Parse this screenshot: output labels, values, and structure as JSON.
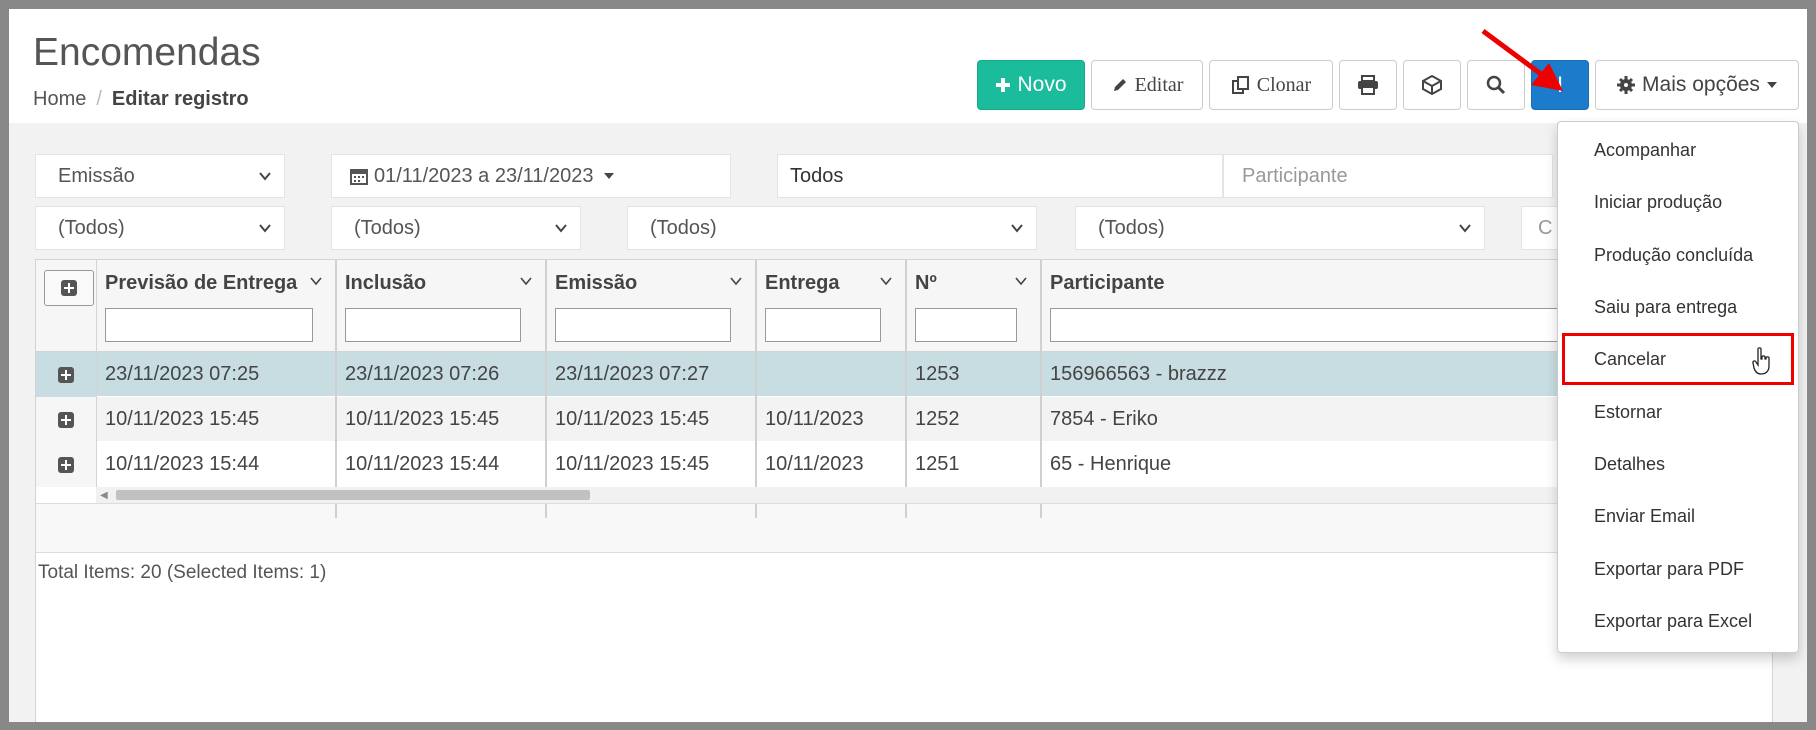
{
  "page": {
    "title": "Encomendas"
  },
  "breadcrumb": {
    "home": "Home",
    "separator": "/",
    "current": "Editar registro"
  },
  "toolbar": {
    "novo_label": "Novo",
    "editar_label": "Editar",
    "clonar_label": "Clonar",
    "info_label": "I",
    "mais_label": "Mais opções",
    "accent_green": "#1abc9c",
    "accent_blue": "#1c7ccb"
  },
  "filters": {
    "date_type": "Emissão",
    "date_range": "01/11/2023 a 23/11/2023",
    "status": "Todos",
    "participant_placeholder": "Participante",
    "select1": "(Todos)",
    "select2": "(Todos)",
    "select3": "(Todos)",
    "select4": "(Todos)",
    "partial": "C"
  },
  "grid": {
    "columns": [
      "Previsão de Entrega",
      "Inclusão",
      "Emissão",
      "Entrega",
      "Nº",
      "Participante"
    ],
    "rows": [
      {
        "previsao": "23/11/2023 07:25",
        "inclusao": "23/11/2023 07:26",
        "emissao": "23/11/2023 07:27",
        "entrega": "",
        "numero": "1253",
        "participante": "156966563 - brazzz"
      },
      {
        "previsao": "10/11/2023 15:45",
        "inclusao": "10/11/2023 15:45",
        "emissao": "10/11/2023 15:45",
        "entrega": "10/11/2023",
        "numero": "1252",
        "participante": "7854 - Eriko"
      },
      {
        "previsao": "10/11/2023 15:44",
        "inclusao": "10/11/2023 15:44",
        "emissao": "10/11/2023 15:45",
        "entrega": "10/11/2023",
        "numero": "1251",
        "participante": "65 - Henrique"
      }
    ],
    "selected_row_color": "#c8dde2",
    "total_text": "Total Items: 20 (Selected Items: 1)"
  },
  "menu": {
    "items": [
      "Acompanhar",
      "Iniciar produção",
      "Produção concluída",
      "Saiu para entrega",
      "Cancelar",
      "Estornar",
      "Detalhes",
      "Enviar Email",
      "Exportar para PDF",
      "Exportar para Excel"
    ],
    "highlighted": "Cancelar",
    "highlight_color": "#e00000"
  }
}
